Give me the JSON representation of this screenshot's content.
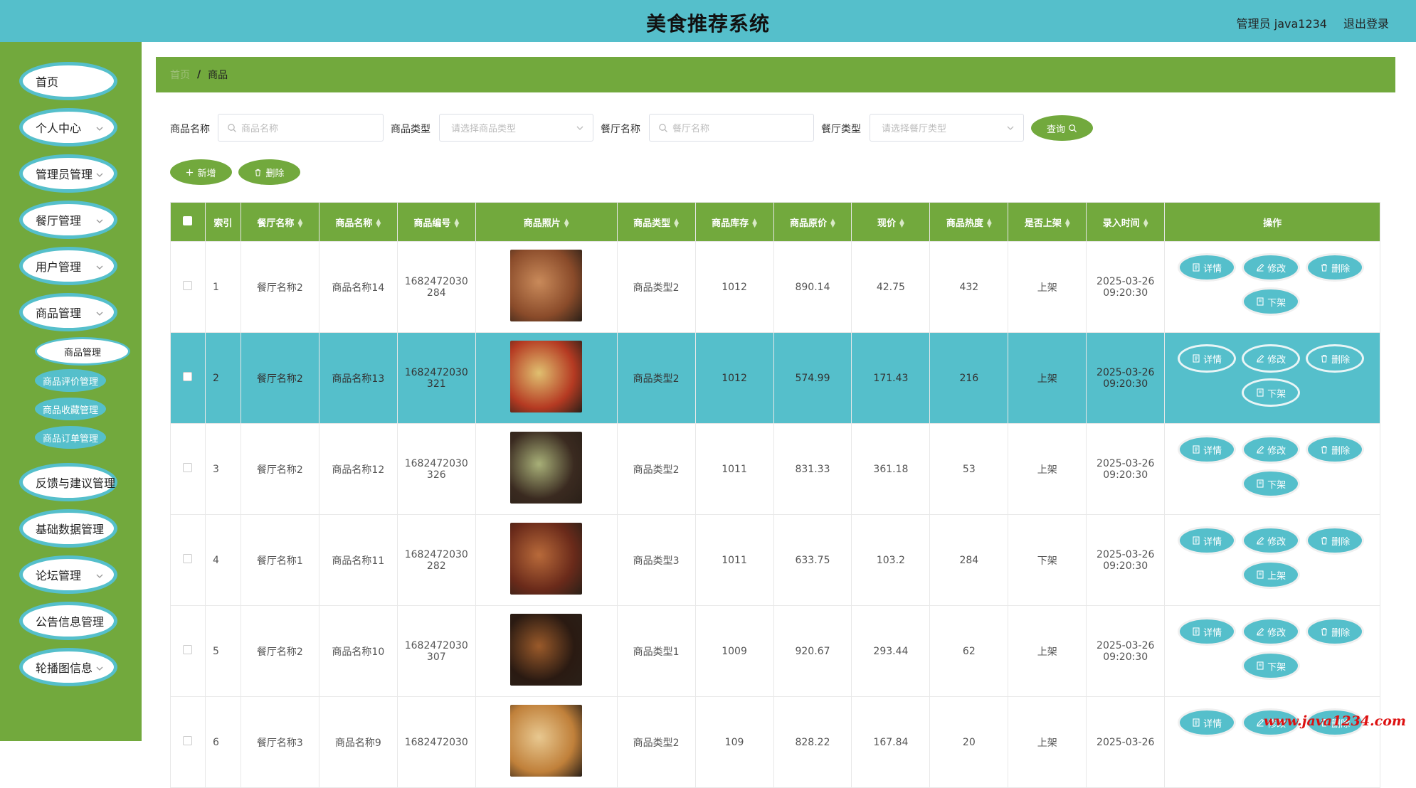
{
  "header": {
    "title": "美食推荐系统",
    "user": "管理员 java1234",
    "logout": "退出登录"
  },
  "sidebar": {
    "items": [
      "首页",
      "个人中心",
      "管理员管理",
      "餐厅管理",
      "用户管理",
      "商品管理",
      "反馈与建议管理",
      "基础数据管理",
      "论坛管理",
      "公告信息管理",
      "轮播图信息"
    ],
    "sub_items": [
      "商品管理",
      "商品评价管理",
      "商品收藏管理",
      "商品订单管理"
    ]
  },
  "breadcrumb": {
    "home": "首页",
    "separator": "/",
    "current": "商品"
  },
  "filters": {
    "name_label": "商品名称",
    "name_placeholder": "商品名称",
    "type_label": "商品类型",
    "type_placeholder": "请选择商品类型",
    "restaurant_label": "餐厅名称",
    "restaurant_placeholder": "餐厅名称",
    "rtype_label": "餐厅类型",
    "rtype_placeholder": "请选择餐厅类型",
    "search_button": "查询"
  },
  "toolbar": {
    "add": "新增",
    "delete": "删除"
  },
  "table": {
    "headers": [
      "索引",
      "餐厅名称",
      "商品名称",
      "商品编号",
      "商品照片",
      "商品类型",
      "商品库存",
      "商品原价",
      "现价",
      "商品热度",
      "是否上架",
      "录入时间",
      "操作"
    ],
    "actions": {
      "detail": "详情",
      "edit": "修改",
      "delete": "删除"
    },
    "rows": [
      {
        "idx": "1",
        "restaurant": "餐厅名称2",
        "name": "商品名称14",
        "code1": "1682472030",
        "code2": "284",
        "type": "商品类型2",
        "stock": "1012",
        "original": "890.14",
        "price": "42.75",
        "heat": "432",
        "listed": "上架",
        "date": "2025-03-26",
        "time": "09:20:30",
        "toggle": "下架"
      },
      {
        "idx": "2",
        "restaurant": "餐厅名称2",
        "name": "商品名称13",
        "code1": "1682472030",
        "code2": "321",
        "type": "商品类型2",
        "stock": "1012",
        "original": "574.99",
        "price": "171.43",
        "heat": "216",
        "listed": "上架",
        "date": "2025-03-26",
        "time": "09:20:30",
        "toggle": "下架"
      },
      {
        "idx": "3",
        "restaurant": "餐厅名称2",
        "name": "商品名称12",
        "code1": "1682472030",
        "code2": "326",
        "type": "商品类型2",
        "stock": "1011",
        "original": "831.33",
        "price": "361.18",
        "heat": "53",
        "listed": "上架",
        "date": "2025-03-26",
        "time": "09:20:30",
        "toggle": "下架"
      },
      {
        "idx": "4",
        "restaurant": "餐厅名称1",
        "name": "商品名称11",
        "code1": "1682472030",
        "code2": "282",
        "type": "商品类型3",
        "stock": "1011",
        "original": "633.75",
        "price": "103.2",
        "heat": "284",
        "listed": "下架",
        "date": "2025-03-26",
        "time": "09:20:30",
        "toggle": "上架"
      },
      {
        "idx": "5",
        "restaurant": "餐厅名称2",
        "name": "商品名称10",
        "code1": "1682472030",
        "code2": "307",
        "type": "商品类型1",
        "stock": "1009",
        "original": "920.67",
        "price": "293.44",
        "heat": "62",
        "listed": "上架",
        "date": "2025-03-26",
        "time": "09:20:30",
        "toggle": "下架"
      },
      {
        "idx": "6",
        "restaurant": "餐厅名称3",
        "name": "商品名称9",
        "code1": "1682472030",
        "code2": "",
        "type": "商品类型2",
        "stock": "109",
        "original": "828.22",
        "price": "167.84",
        "heat": "20",
        "listed": "上架",
        "date": "2025-03-26",
        "time": "",
        "toggle": ""
      }
    ]
  },
  "watermark": "www.java1234.com",
  "colors": {
    "header": "#55bfcb",
    "sidebar": "#72a93d",
    "accent_button": "#55bfcb",
    "table_header": "#72a93d"
  }
}
